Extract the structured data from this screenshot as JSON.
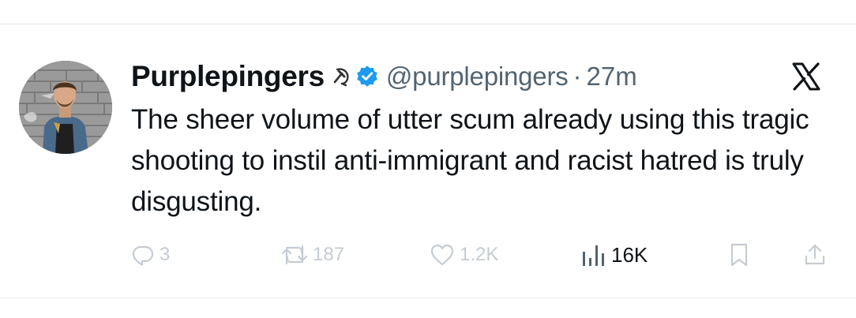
{
  "tweet": {
    "display_name": "Purplepingers",
    "handle": "@purplepingers",
    "separator": "·",
    "time": "27m",
    "text": "The sheer volume of utter scum already using this tragic shooting to instil anti-immigrant and racist hatred is truly disgusting.",
    "name_emoji": "hammer-and-sickle-icon",
    "verified": true,
    "colors": {
      "verified_badge": "#1d9bf0",
      "name_text": "#0f1419",
      "secondary_text": "#536471",
      "faded_action": "#c5ccd3"
    }
  },
  "actions": {
    "replies": "3",
    "retweets": "187",
    "likes": "1.2K",
    "views": "16K"
  },
  "icons": {
    "brand": "x-logo-icon",
    "reply": "reply-icon",
    "retweet": "retweet-icon",
    "like": "heart-icon",
    "views": "views-chart-icon",
    "bookmark": "bookmark-icon",
    "share": "share-icon"
  }
}
